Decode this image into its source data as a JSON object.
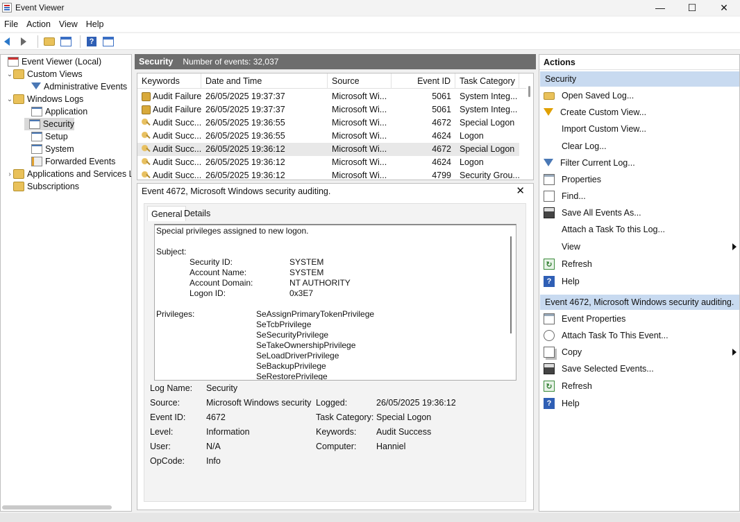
{
  "window": {
    "title": "Event Viewer",
    "minimize": "—",
    "maximize": "☐",
    "close": "✕"
  },
  "menu": [
    "File",
    "Action",
    "View",
    "Help"
  ],
  "tree": [
    {
      "label": "Event Viewer (Local)",
      "exp": "",
      "icon": "ev"
    },
    {
      "label": "Custom Views",
      "exp": "⌄",
      "icon": "folder"
    },
    {
      "label": "Administrative Events",
      "exp": "",
      "icon": "filter"
    },
    {
      "label": "Windows Logs",
      "exp": "⌄",
      "icon": "folder"
    },
    {
      "label": "Application",
      "exp": "",
      "icon": "log"
    },
    {
      "label": "Security",
      "exp": "",
      "icon": "log",
      "selected": true
    },
    {
      "label": "Setup",
      "exp": "",
      "icon": "log"
    },
    {
      "label": "System",
      "exp": "",
      "icon": "log"
    },
    {
      "label": "Forwarded Events",
      "exp": "",
      "icon": "fwd"
    },
    {
      "label": "Applications and Services Lo",
      "exp": "›",
      "icon": "folder"
    },
    {
      "label": "Subscriptions",
      "exp": "",
      "icon": "folder"
    }
  ],
  "middle": {
    "title": "Security",
    "count": "Number of events: 32,037"
  },
  "columns": [
    "Keywords",
    "Date and Time",
    "Source",
    "Event ID",
    "Task Category"
  ],
  "events": [
    {
      "kw": "Audit Failure",
      "icon": "lock",
      "date": "26/05/2025 19:37:37",
      "src": "Microsoft Wi...",
      "id": "5061",
      "cat": "System Integ..."
    },
    {
      "kw": "Audit Failure",
      "icon": "lock",
      "date": "26/05/2025 19:37:37",
      "src": "Microsoft Wi...",
      "id": "5061",
      "cat": "System Integ..."
    },
    {
      "kw": "Audit Succ...",
      "icon": "key",
      "date": "26/05/2025 19:36:55",
      "src": "Microsoft Wi...",
      "id": "4672",
      "cat": "Special Logon"
    },
    {
      "kw": "Audit Succ...",
      "icon": "key",
      "date": "26/05/2025 19:36:55",
      "src": "Microsoft Wi...",
      "id": "4624",
      "cat": "Logon"
    },
    {
      "kw": "Audit Succ...",
      "icon": "key",
      "date": "26/05/2025 19:36:12",
      "src": "Microsoft Wi...",
      "id": "4672",
      "cat": "Special Logon",
      "selected": true
    },
    {
      "kw": "Audit Succ...",
      "icon": "key",
      "date": "26/05/2025 19:36:12",
      "src": "Microsoft Wi...",
      "id": "4624",
      "cat": "Logon"
    },
    {
      "kw": "Audit Succ...",
      "icon": "key",
      "date": "26/05/2025 19:36:12",
      "src": "Microsoft Wi...",
      "id": "4799",
      "cat": "Security Grou..."
    }
  ],
  "detail": {
    "title": "Event 4672, Microsoft Windows security auditing.",
    "close": "✕",
    "tabs": [
      "General",
      "Details"
    ],
    "description": {
      "intro": "Special privileges assigned to new logon.",
      "subject_label": "Subject:",
      "subject": [
        [
          "Security ID:",
          "SYSTEM"
        ],
        [
          "Account Name:",
          "SYSTEM"
        ],
        [
          "Account Domain:",
          "NT AUTHORITY"
        ],
        [
          "Logon ID:",
          "0x3E7"
        ]
      ],
      "privileges_label": "Privileges:",
      "privileges": [
        "SeAssignPrimaryTokenPrivilege",
        "SeTcbPrivilege",
        "SeSecurityPrivilege",
        "SeTakeOwnershipPrivilege",
        "SeLoadDriverPrivilege",
        "SeBackupPrivilege",
        "SeRestorePrivilege"
      ]
    },
    "props_left": [
      [
        "Log Name:",
        "Security"
      ],
      [
        "Source:",
        "Microsoft Windows security"
      ],
      [
        "Event ID:",
        "4672"
      ],
      [
        "Level:",
        "Information"
      ],
      [
        "User:",
        "N/A"
      ],
      [
        "OpCode:",
        "Info"
      ]
    ],
    "props_right": [
      [
        "Logged:",
        "26/05/2025 19:36:12"
      ],
      [
        "Task Category:",
        "Special Logon"
      ],
      [
        "Keywords:",
        "Audit Success"
      ],
      [
        "Computer:",
        "Hanniel"
      ]
    ]
  },
  "actions": {
    "title": "Actions",
    "section1": "Security",
    "items1": [
      {
        "label": "Open Saved Log...",
        "icon": "i-open"
      },
      {
        "label": "Create Custom View...",
        "icon": "i-funnel"
      },
      {
        "label": "Import Custom View...",
        "icon": ""
      },
      {
        "label": "Clear Log...",
        "icon": ""
      },
      {
        "label": "Filter Current Log...",
        "icon": "i-filt"
      },
      {
        "label": "Properties",
        "icon": "i-doc"
      },
      {
        "label": "Find...",
        "icon": "i-find"
      },
      {
        "label": "Save All Events As...",
        "icon": "i-save"
      },
      {
        "label": "Attach a Task To this Log...",
        "icon": ""
      },
      {
        "label": "View",
        "icon": "",
        "submenu": true
      },
      {
        "label": "Refresh",
        "icon": "i-ref"
      },
      {
        "label": "Help",
        "icon": "i-help"
      }
    ],
    "section2": "Event 4672, Microsoft Windows security auditing.",
    "items2": [
      {
        "label": "Event Properties",
        "icon": "i-doc"
      },
      {
        "label": "Attach Task To This Event...",
        "icon": "i-task"
      },
      {
        "label": "Copy",
        "icon": "i-copy",
        "submenu": true
      },
      {
        "label": "Save Selected Events...",
        "icon": "i-save"
      },
      {
        "label": "Refresh",
        "icon": "i-ref"
      },
      {
        "label": "Help",
        "icon": "i-help"
      }
    ]
  }
}
